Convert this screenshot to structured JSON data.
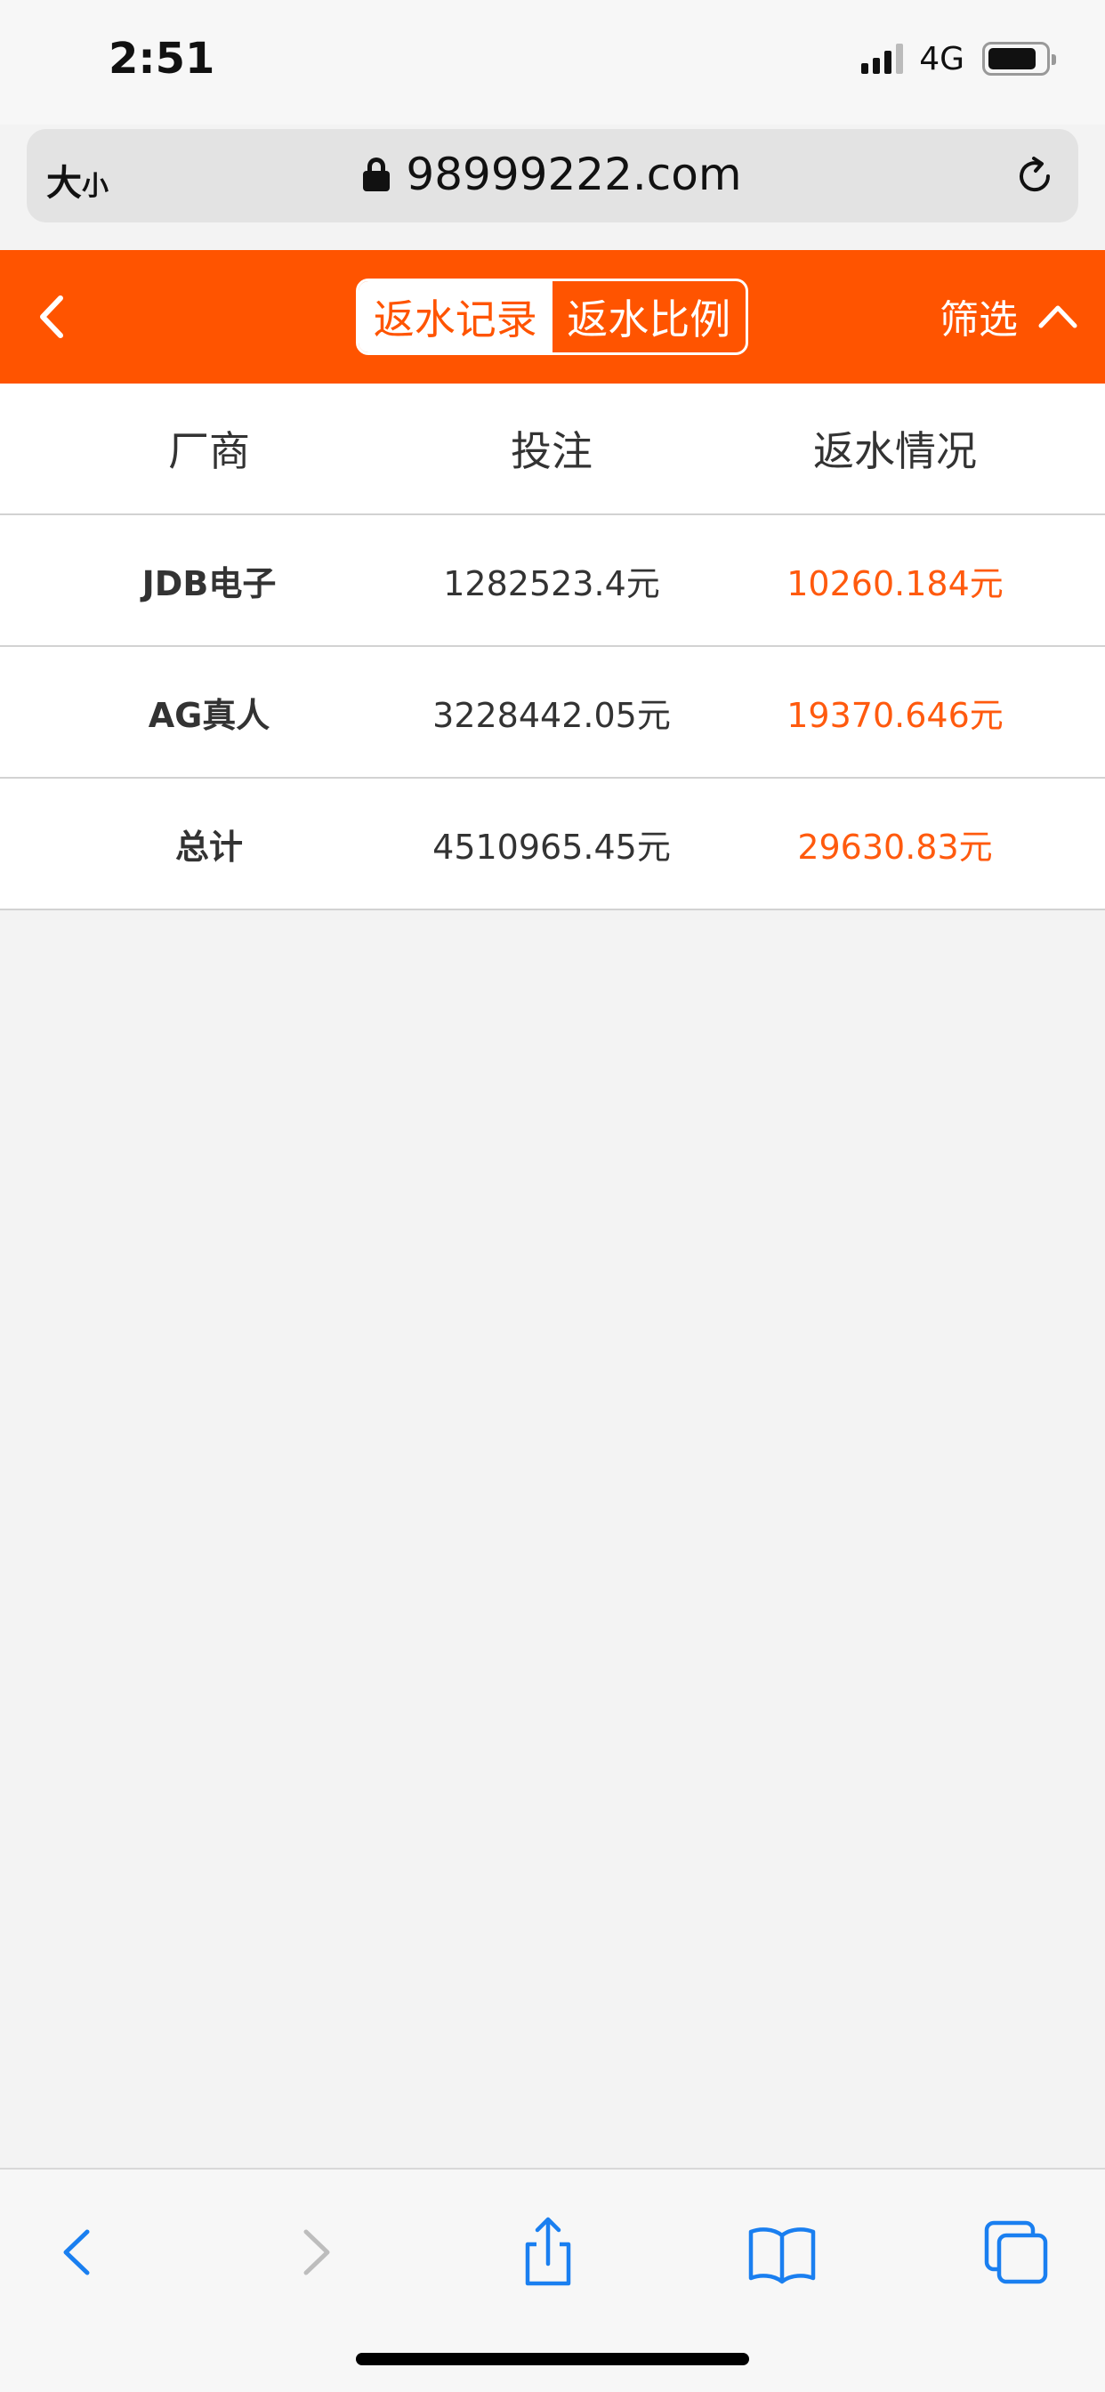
{
  "status_bar": {
    "time": "2:51",
    "network": "4G",
    "battery_level": 0.85
  },
  "browser": {
    "text_size_big": "大",
    "text_size_small": "小",
    "url": "98999222.com"
  },
  "header": {
    "tabs": [
      {
        "label": "返水记录",
        "active": true
      },
      {
        "label": "返水比例",
        "active": false
      }
    ],
    "filter_label": "筛选",
    "accent": "#ff5400"
  },
  "table": {
    "headers": [
      "厂商",
      "投注",
      "返水情况"
    ],
    "rows": [
      {
        "vendor": "JDB电子",
        "bet": "1282523.4元",
        "rebate": "10260.184元"
      },
      {
        "vendor": "AG真人",
        "bet": "3228442.05元",
        "rebate": "19370.646元"
      },
      {
        "vendor": "总计",
        "bet": "4510965.45元",
        "rebate": "29630.83元"
      }
    ],
    "rebate_color": "#ff5a0e"
  },
  "toolbar": {
    "icons": [
      "back-icon",
      "forward-icon",
      "share-icon",
      "bookmarks-icon",
      "tabs-icon"
    ]
  }
}
